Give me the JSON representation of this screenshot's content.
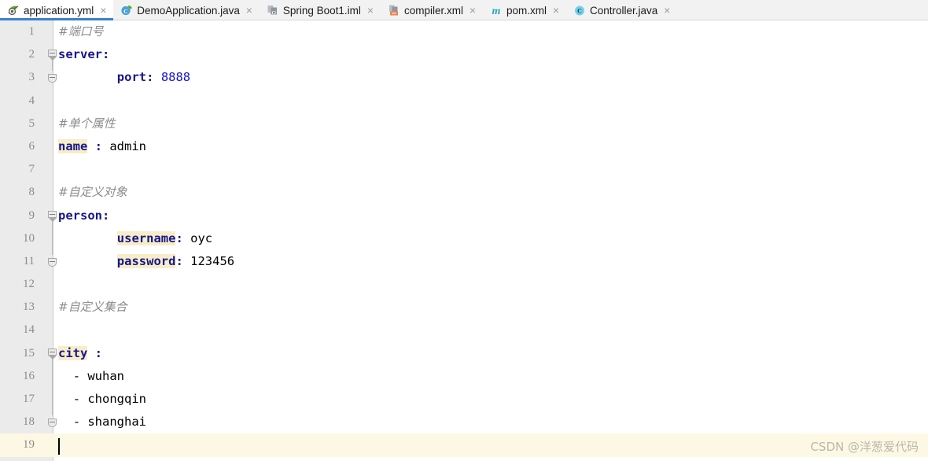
{
  "tabs": [
    {
      "label": "application.yml",
      "icon": "spring-yaml-icon",
      "active": true,
      "close": "×"
    },
    {
      "label": "DemoApplication.java",
      "icon": "spring-java-class-icon",
      "active": false,
      "close": "×"
    },
    {
      "label": "Spring Boot1.iml",
      "icon": "iml-module-icon",
      "active": false,
      "close": "×"
    },
    {
      "label": "compiler.xml",
      "icon": "xml-file-icon",
      "active": false,
      "close": "×"
    },
    {
      "label": "pom.xml",
      "icon": "maven-pom-icon",
      "active": false,
      "close": "×"
    },
    {
      "label": "Controller.java",
      "icon": "java-class-icon",
      "active": false,
      "close": "×"
    }
  ],
  "editor": {
    "language": "yaml",
    "caret_line": 19,
    "lines": [
      {
        "n": "1",
        "indent": 0,
        "type": "comment",
        "text": "#端口号"
      },
      {
        "n": "2",
        "indent": 0,
        "type": "mapping",
        "key": "server",
        "key_highlight": false,
        "sep": ":",
        "value": ""
      },
      {
        "n": "3",
        "indent": 8,
        "type": "mapping",
        "key": "port",
        "key_highlight": false,
        "sep": ":",
        "value": "8888",
        "value_kind": "number"
      },
      {
        "n": "4",
        "indent": 0,
        "type": "blank",
        "text": ""
      },
      {
        "n": "5",
        "indent": 0,
        "type": "comment",
        "text": "#单个属性"
      },
      {
        "n": "6",
        "indent": 0,
        "type": "mapping",
        "key": "name",
        "key_highlight": true,
        "sep": " :",
        "value": "admin",
        "value_kind": "plain"
      },
      {
        "n": "7",
        "indent": 0,
        "type": "blank",
        "text": ""
      },
      {
        "n": "8",
        "indent": 0,
        "type": "comment",
        "text": "#自定义对象"
      },
      {
        "n": "9",
        "indent": 0,
        "type": "mapping",
        "key": "person",
        "key_highlight": false,
        "sep": ":",
        "value": ""
      },
      {
        "n": "10",
        "indent": 8,
        "type": "mapping",
        "key": "username",
        "key_highlight": true,
        "sep": ":",
        "value": "oyc",
        "value_kind": "plain"
      },
      {
        "n": "11",
        "indent": 8,
        "type": "mapping",
        "key": "password",
        "key_highlight": true,
        "sep": ":",
        "value": "123456",
        "value_kind": "plain"
      },
      {
        "n": "12",
        "indent": 0,
        "type": "blank",
        "text": ""
      },
      {
        "n": "13",
        "indent": 0,
        "type": "comment",
        "text": "#自定义集合"
      },
      {
        "n": "14",
        "indent": 0,
        "type": "blank",
        "text": ""
      },
      {
        "n": "15",
        "indent": 0,
        "type": "mapping",
        "key": "city",
        "key_highlight": true,
        "sep": " :",
        "value": ""
      },
      {
        "n": "16",
        "indent": 2,
        "type": "seq",
        "text": "- wuhan"
      },
      {
        "n": "17",
        "indent": 2,
        "type": "seq",
        "text": "- chongqin"
      },
      {
        "n": "18",
        "indent": 2,
        "type": "seq",
        "text": "- shanghai"
      },
      {
        "n": "19",
        "indent": 0,
        "type": "blank",
        "text": ""
      }
    ],
    "fold_markers": [
      {
        "line": 2,
        "kind": "open"
      },
      {
        "line": 3,
        "kind": "close"
      },
      {
        "line": 9,
        "kind": "open"
      },
      {
        "line": 11,
        "kind": "close"
      },
      {
        "line": 15,
        "kind": "open"
      },
      {
        "line": 18,
        "kind": "close"
      }
    ]
  },
  "watermark": {
    "text": "CSDN @洋葱爱代码"
  },
  "colors": {
    "accent": "#3c7fd0",
    "key": "#17178b",
    "number": "#1616d6",
    "comment": "#8c8c8c",
    "highlight": "#f7edc8",
    "caret_line": "#fdf8e3",
    "gutter": "#ebebeb",
    "tabbar": "#f2f2f2"
  }
}
